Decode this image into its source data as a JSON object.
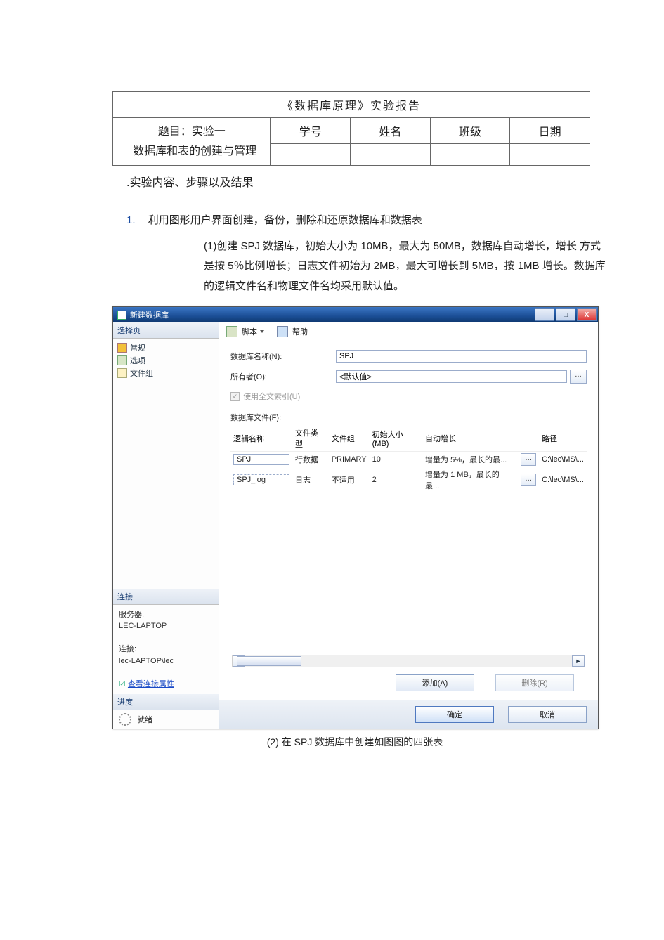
{
  "report": {
    "title": "《数据库原理》实验报告",
    "topic_label": "题目：实验一",
    "topic_sub": "数据库和表的创建与管理",
    "cols": {
      "id": "学号",
      "name": "姓名",
      "class": "班级",
      "date": "日期"
    }
  },
  "section_heading": ".实验内容、步骤以及结果",
  "item1": {
    "num": "1.",
    "text": "利用图形用户界面创建，备份，删除和还原数据库和数据表",
    "sub1": "(1)创建 SPJ 数据库，初始大小为 10MB，最大为 50MB，数据库自动增长，增长 方式是按 5％比例增长；日志文件初始为 2MB，最大可增长到 5MB，按 1MB 增长。数据库的逻辑文件名和物理文件名均采用默认值。",
    "sub2_caption": "(2) 在 SPJ 数据库中创建如图图的四张表"
  },
  "dialog": {
    "title": "新建数据库",
    "win_buttons": {
      "min": "_",
      "max": "□",
      "close": "X"
    },
    "nav": {
      "select_page": "选择页",
      "items": [
        {
          "icon": "general",
          "label": "常规"
        },
        {
          "icon": "option",
          "label": "选项"
        },
        {
          "icon": "fg",
          "label": "文件组"
        }
      ],
      "connection_header": "连接",
      "server_label": "服务器:",
      "server_value": "LEC-LAPTOP",
      "conn_label": "连接:",
      "conn_value": "lec-LAPTOP\\lec",
      "view_props": "查看连接属性",
      "progress_header": "进度",
      "progress_status": "就绪"
    },
    "toolbar": {
      "script": "脚本",
      "help": "帮助"
    },
    "form": {
      "db_name_label": "数据库名称(N):",
      "db_name_value": "SPJ",
      "owner_label": "所有者(O):",
      "owner_value": "<默认值>",
      "fulltext_label": "使用全文索引(U)",
      "files_label": "数据库文件(F):"
    },
    "file_table": {
      "headers": {
        "logical": "逻辑名称",
        "ftype": "文件类型",
        "fgroup": "文件组",
        "initsize": "初始大小(MB)",
        "autogrow": "自动增长",
        "path": "路径"
      },
      "rows": [
        {
          "logical": "SPJ",
          "ftype": "行数据",
          "fgroup": "PRIMARY",
          "initsize": "10",
          "autogrow": "增量为 5%，最长的最...",
          "path": "C:\\lec\\MS\\..."
        },
        {
          "logical": "SPJ_log",
          "ftype": "日志",
          "fgroup": "不适用",
          "initsize": "2",
          "autogrow": "增量为 1 MB，最长的最...",
          "path": "C:\\lec\\MS\\..."
        }
      ]
    },
    "actions": {
      "add": "添加(A)",
      "remove": "删除(R)"
    },
    "footer": {
      "ok": "确定",
      "cancel": "取消"
    }
  }
}
